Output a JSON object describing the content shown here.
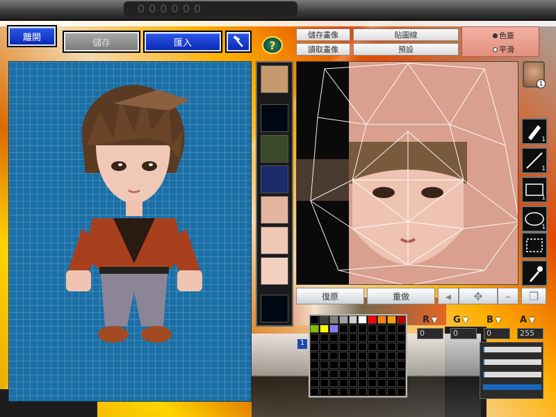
{
  "top_bar": {
    "leave_label": "離開",
    "save_label": "儲存",
    "import_label": "匯入",
    "help_label": "?"
  },
  "texture_controls": {
    "save_texture": "儲存畫像",
    "load_texture": "讀取畫像",
    "texture_line": "貼圖線",
    "default": "預設",
    "radio_color": "色簽",
    "radio_smooth": "平滑",
    "radio_selected": "色簽"
  },
  "texture_buttons": {
    "undo": "復原",
    "redo": "重做"
  },
  "avatar_badge": "1",
  "tools": [
    {
      "icon": "pen-icon",
      "count": "1"
    },
    {
      "icon": "line-icon",
      "count": "1"
    },
    {
      "icon": "rectangle-icon",
      "count": "1"
    },
    {
      "icon": "ellipse-icon",
      "count": "1"
    },
    {
      "icon": "selection-icon",
      "count": ""
    },
    {
      "icon": "eyedropper-icon",
      "count": ""
    }
  ],
  "rgb": {
    "r_label": "R",
    "g_label": "G",
    "b_label": "B",
    "a_label": "A",
    "r_value": "0",
    "g_value": "0",
    "b_value": "0",
    "a_value": "255",
    "r_level": 0.02,
    "g_level": 0.02,
    "b_level": 0.02,
    "a_level": 1.0
  },
  "side_number": "1",
  "palette_colors": [
    "#000000",
    "#404040",
    "#808080",
    "#a0a0a0",
    "#d0d0d0",
    "#ffffff",
    "#ff0000",
    "#ff8000",
    "#ffa000",
    "#c00000",
    "#80c000",
    "#ffff00",
    "#8080ff",
    "#000000",
    "#000000",
    "#000000",
    "#000000",
    "#000000",
    "#000000",
    "#000000"
  ],
  "colors": {
    "preview_bg": "#1a6fa6",
    "accent_blue": "#0a2bb6",
    "skin": "#d9a08f"
  }
}
